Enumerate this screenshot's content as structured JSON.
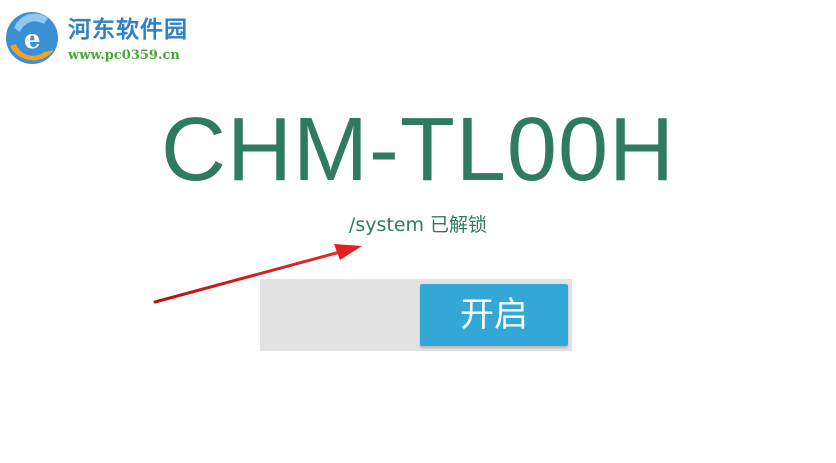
{
  "watermark": {
    "site_name": "河东软件园",
    "url": "www.pc0359.cn"
  },
  "device": {
    "model": "CHM-TL00H",
    "status": "/system 已解锁"
  },
  "toggle": {
    "button_label": "开启"
  },
  "colors": {
    "accent_green": "#2e7a62",
    "button_blue": "#33a7d6",
    "track_gray": "#e2e2e2",
    "annotation_red": "#d62020"
  },
  "icons": {
    "watermark_logo": "pc0359-logo-icon",
    "annotation": "red-arrow-icon"
  }
}
